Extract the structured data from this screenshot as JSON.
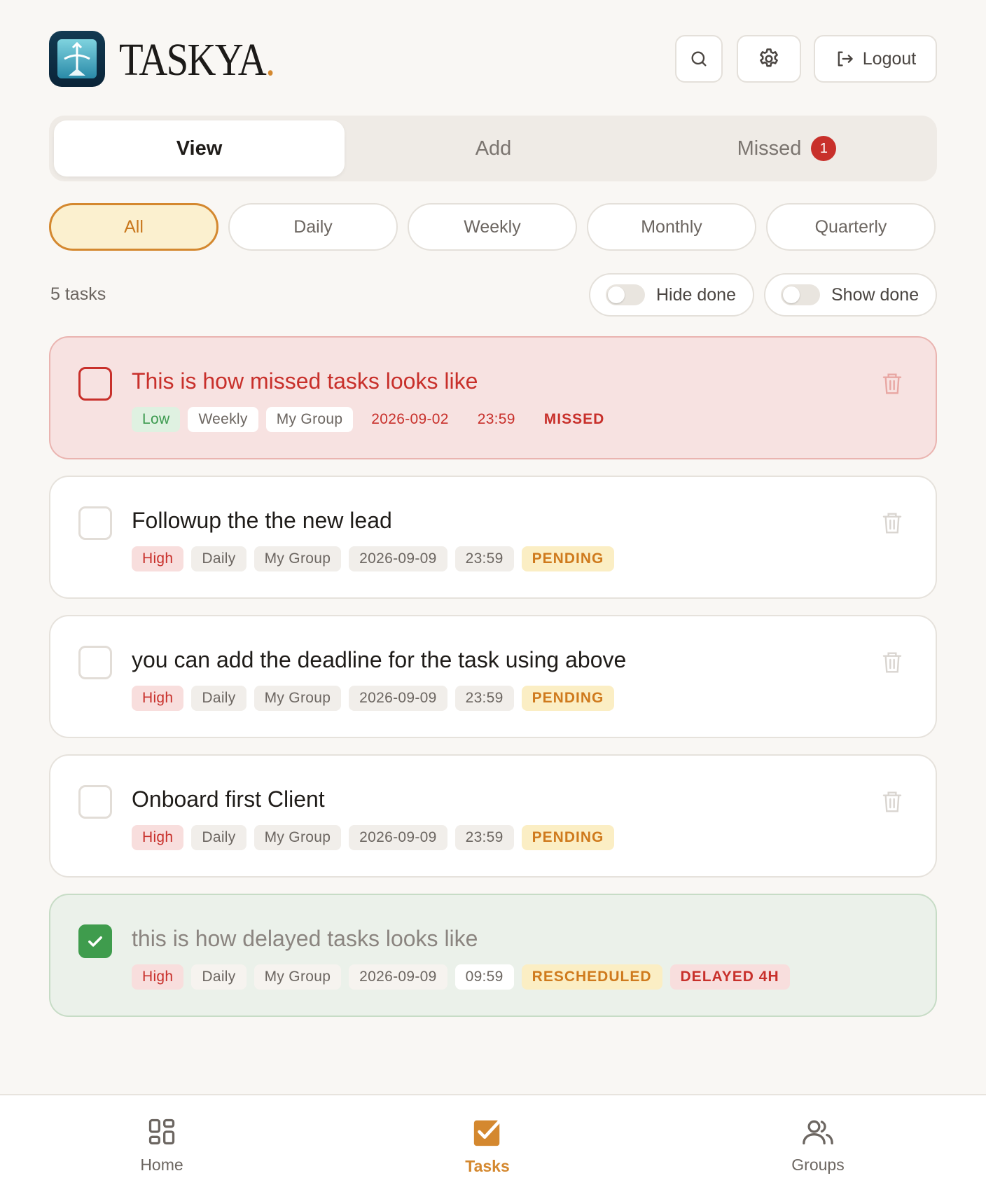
{
  "brand": {
    "name": "TASKYA",
    "dot": "."
  },
  "header": {
    "search_icon": "search-icon",
    "settings_icon": "gear-icon",
    "logout_label": "Logout"
  },
  "tabs": [
    {
      "label": "View",
      "active": true
    },
    {
      "label": "Add",
      "active": false
    },
    {
      "label": "Missed",
      "active": false,
      "badge": "1"
    }
  ],
  "filters": [
    {
      "label": "All",
      "active": true
    },
    {
      "label": "Daily",
      "active": false
    },
    {
      "label": "Weekly",
      "active": false
    },
    {
      "label": "Monthly",
      "active": false
    },
    {
      "label": "Quarterly",
      "active": false
    }
  ],
  "summary": {
    "count": "5 tasks",
    "hide_done": "Hide done",
    "show_done": "Show done"
  },
  "tasks": [
    {
      "title": "This is how missed tasks looks like",
      "state": "missed",
      "checked": false,
      "tags": [
        "Low",
        "Weekly",
        "My Group",
        "2026-09-02",
        "23:59",
        "MISSED"
      ]
    },
    {
      "title": "Followup the the new lead",
      "state": "normal",
      "checked": false,
      "tags": [
        "High",
        "Daily",
        "My Group",
        "2026-09-09",
        "23:59",
        "PENDING"
      ]
    },
    {
      "title": "you can add the deadline for the task using above",
      "state": "normal",
      "checked": false,
      "tags": [
        "High",
        "Daily",
        "My Group",
        "2026-09-09",
        "23:59",
        "PENDING"
      ]
    },
    {
      "title": "Onboard first Client",
      "state": "normal",
      "checked": false,
      "tags": [
        "High",
        "Daily",
        "My Group",
        "2026-09-09",
        "23:59",
        "PENDING"
      ]
    },
    {
      "title": "this is how delayed tasks looks like",
      "state": "done",
      "checked": true,
      "tags": [
        "High",
        "Daily",
        "My Group",
        "2026-09-09",
        "09:59",
        "RESCHEDULED",
        "DELAYED 4H"
      ]
    }
  ],
  "bottom_nav": [
    {
      "label": "Home",
      "icon": "home-grid-icon",
      "active": false
    },
    {
      "label": "Tasks",
      "icon": "tasks-check-icon",
      "active": true
    },
    {
      "label": "Groups",
      "icon": "users-icon",
      "active": false
    }
  ],
  "colors": {
    "accent": "#d4882f",
    "danger": "#c8302b",
    "success": "#3f9c4d",
    "background": "#f9f7f4"
  }
}
